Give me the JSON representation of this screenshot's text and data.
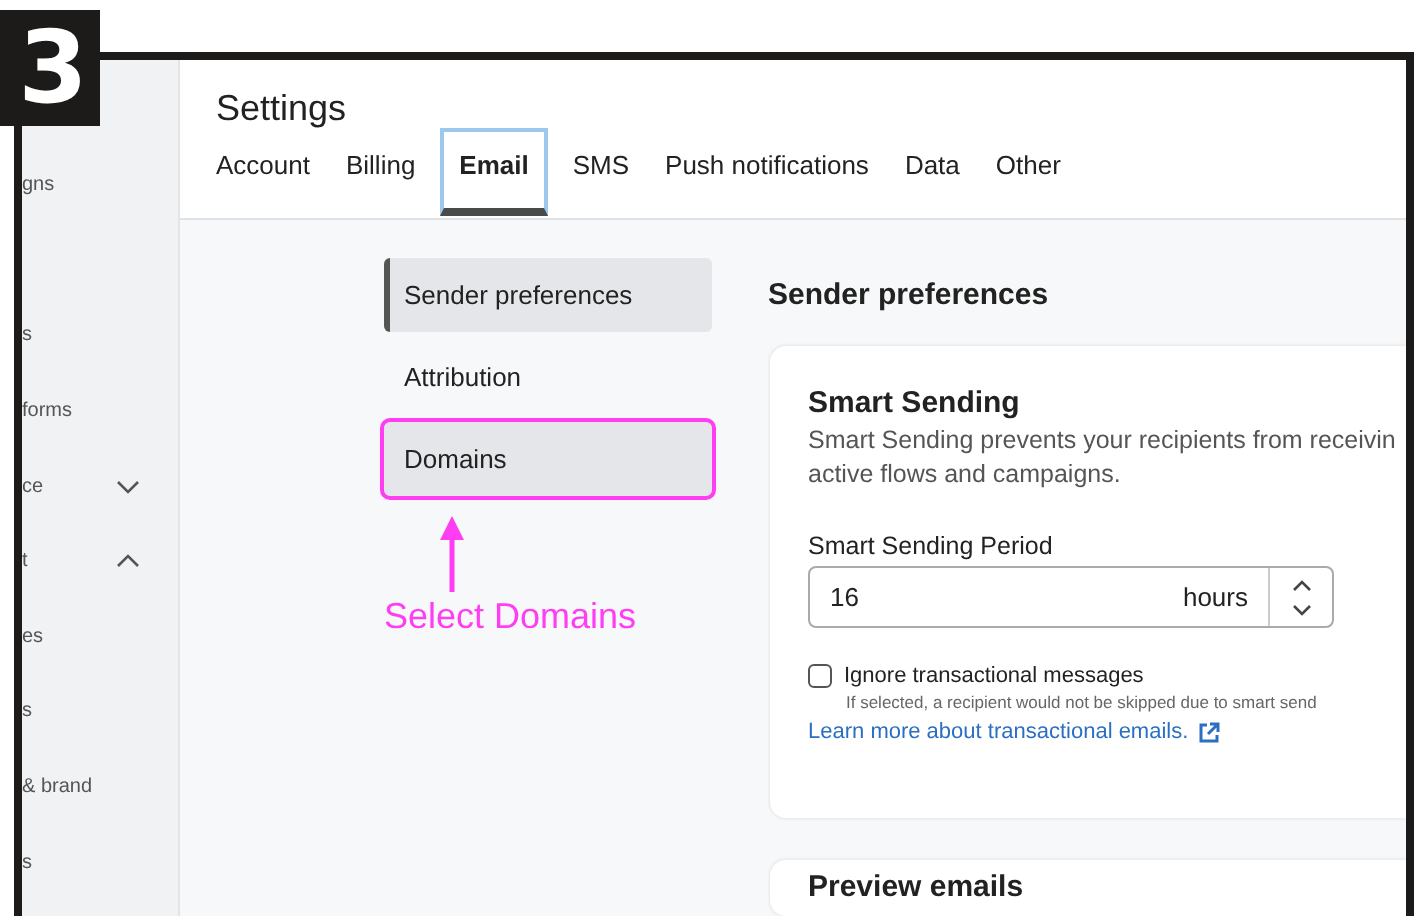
{
  "step_badge": "3",
  "sidebar": {
    "items": [
      {
        "label": "gns"
      },
      {
        "label": "s"
      },
      {
        "label": "forms"
      },
      {
        "label": "ce",
        "expanded": false
      },
      {
        "label": "t",
        "expanded": true
      },
      {
        "label": "es"
      },
      {
        "label": "s"
      },
      {
        "label": "& brand"
      },
      {
        "label": "s"
      }
    ]
  },
  "header": {
    "title": "Settings",
    "tabs": [
      {
        "label": "Account",
        "selected": false
      },
      {
        "label": "Billing",
        "selected": false
      },
      {
        "label": "Email",
        "selected": true
      },
      {
        "label": "SMS",
        "selected": false
      },
      {
        "label": "Push notifications",
        "selected": false
      },
      {
        "label": "Data",
        "selected": false
      },
      {
        "label": "Other",
        "selected": false
      }
    ]
  },
  "settings_nav": [
    {
      "label": "Sender preferences",
      "selected": true,
      "highlighted": false
    },
    {
      "label": "Attribution",
      "selected": false,
      "highlighted": false
    },
    {
      "label": "Domains",
      "selected": false,
      "highlighted": true
    }
  ],
  "annotation": {
    "label": "Select Domains"
  },
  "section_title": "Sender preferences",
  "smart_sending": {
    "title": "Smart Sending",
    "description": "Smart Sending prevents your recipients from receivin",
    "description_line_2": "active flows and campaigns.",
    "period_label": "Smart Sending Period",
    "period_value": "16",
    "period_unit": "hours",
    "ignore_label": "Ignore transactional messages",
    "ignore_checked": false,
    "ignore_help": "If selected, a recipient would not be skipped due to smart send",
    "link": "Learn more about transactional emails."
  },
  "next_card_title": "Preview emails"
}
